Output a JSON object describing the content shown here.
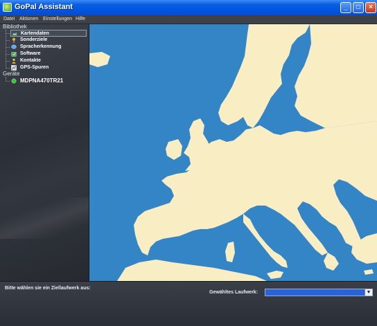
{
  "window": {
    "title": "GoPal Assistant"
  },
  "menu": [
    "Datei",
    "Aktionen",
    "Einstellungen",
    "Hilfe"
  ],
  "sidebar": {
    "library_title": "Bibliothek",
    "items": [
      {
        "label": "Kartendaten",
        "icon": "map-icon"
      },
      {
        "label": "Sonderziele",
        "icon": "pin-icon"
      },
      {
        "label": "Spracherkennung",
        "icon": "speech-icon"
      },
      {
        "label": "Software",
        "icon": "software-icon"
      },
      {
        "label": "Kontakte",
        "icon": "contacts-icon"
      },
      {
        "label": "GPS-Spuren",
        "icon": "gps-track-icon"
      }
    ],
    "devices_title": "Geräte",
    "devices": [
      {
        "label": "MDPNA470TR21",
        "icon": "green-dot-icon"
      }
    ]
  },
  "bottom": {
    "prompt": "Bitte wählen sie ein Ziellaufwerk aus:",
    "drive_label": "Gewähltes Laufwerk:",
    "drive_value": ""
  },
  "colors": {
    "sea": "#3385c6",
    "land": "#f9edc4",
    "titlebar": "#0054e3"
  }
}
